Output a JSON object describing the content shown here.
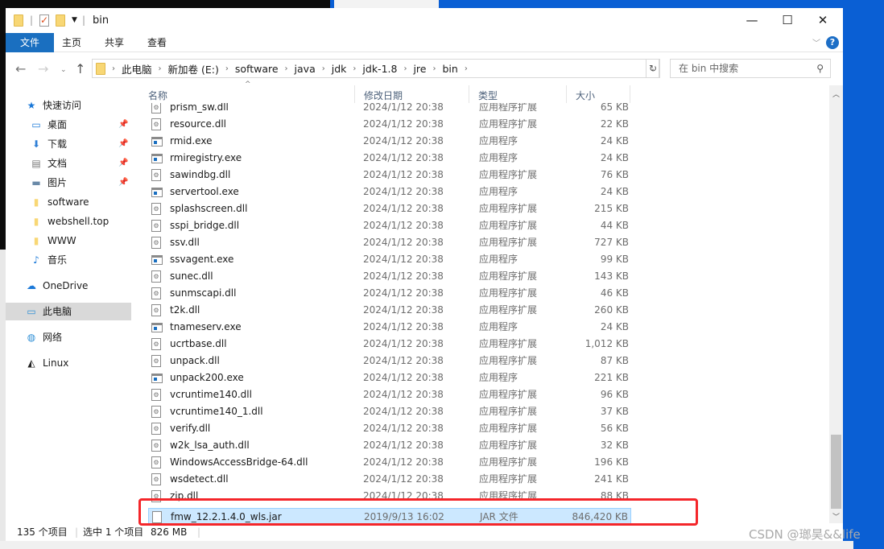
{
  "window": {
    "title": "bin",
    "controls": {
      "minimize": "—",
      "maximize": "☐",
      "close": "✕"
    }
  },
  "ribbon": {
    "tabs": [
      "文件",
      "主页",
      "共享",
      "查看"
    ],
    "help": "?"
  },
  "address": {
    "crumbs": [
      "此电脑",
      "新加卷 (E:)",
      "software",
      "java",
      "jdk",
      "jdk-1.8",
      "jre",
      "bin"
    ]
  },
  "search": {
    "placeholder": "在 bin 中搜索"
  },
  "sidebar": {
    "items": [
      {
        "label": "快速访问",
        "icon": "star-icon"
      },
      {
        "label": "桌面",
        "icon": "desktop-icon",
        "pinned": true
      },
      {
        "label": "下载",
        "icon": "download-icon",
        "pinned": true
      },
      {
        "label": "文档",
        "icon": "document-icon",
        "pinned": true
      },
      {
        "label": "图片",
        "icon": "pictures-icon",
        "pinned": true
      },
      {
        "label": "software",
        "icon": "folder-icon"
      },
      {
        "label": "webshell.top",
        "icon": "folder-icon"
      },
      {
        "label": "WWW",
        "icon": "folder-icon"
      },
      {
        "label": "音乐",
        "icon": "music-icon"
      },
      {
        "label": "OneDrive",
        "icon": "cloud-icon"
      },
      {
        "label": "此电脑",
        "icon": "computer-icon",
        "selected": true
      },
      {
        "label": "网络",
        "icon": "network-icon"
      },
      {
        "label": "Linux",
        "icon": "linux-icon"
      }
    ]
  },
  "columns": {
    "name": "名称",
    "date": "修改日期",
    "type": "类型",
    "size": "大小"
  },
  "files": [
    {
      "name": "prism_sw.dll",
      "date": "2024/1/12 20:38",
      "type": "应用程序扩展",
      "size": "65 KB",
      "kind": "dll"
    },
    {
      "name": "resource.dll",
      "date": "2024/1/12 20:38",
      "type": "应用程序扩展",
      "size": "22 KB",
      "kind": "dll"
    },
    {
      "name": "rmid.exe",
      "date": "2024/1/12 20:38",
      "type": "应用程序",
      "size": "24 KB",
      "kind": "exe"
    },
    {
      "name": "rmiregistry.exe",
      "date": "2024/1/12 20:38",
      "type": "应用程序",
      "size": "24 KB",
      "kind": "exe"
    },
    {
      "name": "sawindbg.dll",
      "date": "2024/1/12 20:38",
      "type": "应用程序扩展",
      "size": "76 KB",
      "kind": "dll"
    },
    {
      "name": "servertool.exe",
      "date": "2024/1/12 20:38",
      "type": "应用程序",
      "size": "24 KB",
      "kind": "exe"
    },
    {
      "name": "splashscreen.dll",
      "date": "2024/1/12 20:38",
      "type": "应用程序扩展",
      "size": "215 KB",
      "kind": "dll"
    },
    {
      "name": "sspi_bridge.dll",
      "date": "2024/1/12 20:38",
      "type": "应用程序扩展",
      "size": "44 KB",
      "kind": "dll"
    },
    {
      "name": "ssv.dll",
      "date": "2024/1/12 20:38",
      "type": "应用程序扩展",
      "size": "727 KB",
      "kind": "dll"
    },
    {
      "name": "ssvagent.exe",
      "date": "2024/1/12 20:38",
      "type": "应用程序",
      "size": "99 KB",
      "kind": "exe"
    },
    {
      "name": "sunec.dll",
      "date": "2024/1/12 20:38",
      "type": "应用程序扩展",
      "size": "143 KB",
      "kind": "dll"
    },
    {
      "name": "sunmscapi.dll",
      "date": "2024/1/12 20:38",
      "type": "应用程序扩展",
      "size": "46 KB",
      "kind": "dll"
    },
    {
      "name": "t2k.dll",
      "date": "2024/1/12 20:38",
      "type": "应用程序扩展",
      "size": "260 KB",
      "kind": "dll"
    },
    {
      "name": "tnameserv.exe",
      "date": "2024/1/12 20:38",
      "type": "应用程序",
      "size": "24 KB",
      "kind": "exe"
    },
    {
      "name": "ucrtbase.dll",
      "date": "2024/1/12 20:38",
      "type": "应用程序扩展",
      "size": "1,012 KB",
      "kind": "dll"
    },
    {
      "name": "unpack.dll",
      "date": "2024/1/12 20:38",
      "type": "应用程序扩展",
      "size": "87 KB",
      "kind": "dll"
    },
    {
      "name": "unpack200.exe",
      "date": "2024/1/12 20:38",
      "type": "应用程序",
      "size": "221 KB",
      "kind": "exe"
    },
    {
      "name": "vcruntime140.dll",
      "date": "2024/1/12 20:38",
      "type": "应用程序扩展",
      "size": "96 KB",
      "kind": "dll"
    },
    {
      "name": "vcruntime140_1.dll",
      "date": "2024/1/12 20:38",
      "type": "应用程序扩展",
      "size": "37 KB",
      "kind": "dll"
    },
    {
      "name": "verify.dll",
      "date": "2024/1/12 20:38",
      "type": "应用程序扩展",
      "size": "56 KB",
      "kind": "dll"
    },
    {
      "name": "w2k_lsa_auth.dll",
      "date": "2024/1/12 20:38",
      "type": "应用程序扩展",
      "size": "32 KB",
      "kind": "dll"
    },
    {
      "name": "WindowsAccessBridge-64.dll",
      "date": "2024/1/12 20:38",
      "type": "应用程序扩展",
      "size": "196 KB",
      "kind": "dll"
    },
    {
      "name": "wsdetect.dll",
      "date": "2024/1/12 20:38",
      "type": "应用程序扩展",
      "size": "241 KB",
      "kind": "dll"
    },
    {
      "name": "zip.dll",
      "date": "2024/1/12 20:38",
      "type": "应用程序扩展",
      "size": "88 KB",
      "kind": "dll"
    },
    {
      "name": "fmw_12.2.1.4.0_wls.jar",
      "date": "2019/9/13 16:02",
      "type": "JAR 文件",
      "size": "846,420 KB",
      "kind": "jar",
      "selected": true
    }
  ],
  "status": {
    "count": "135 个项目",
    "selected": "选中 1 个项目",
    "size": "826 MB"
  },
  "watermark": "CSDN @瑯昊&&life",
  "colors": {
    "accent": "#1a6fc0",
    "selection": "#cce8ff",
    "highlight_box": "#f4262a",
    "desktop": "#0a5fd4"
  }
}
